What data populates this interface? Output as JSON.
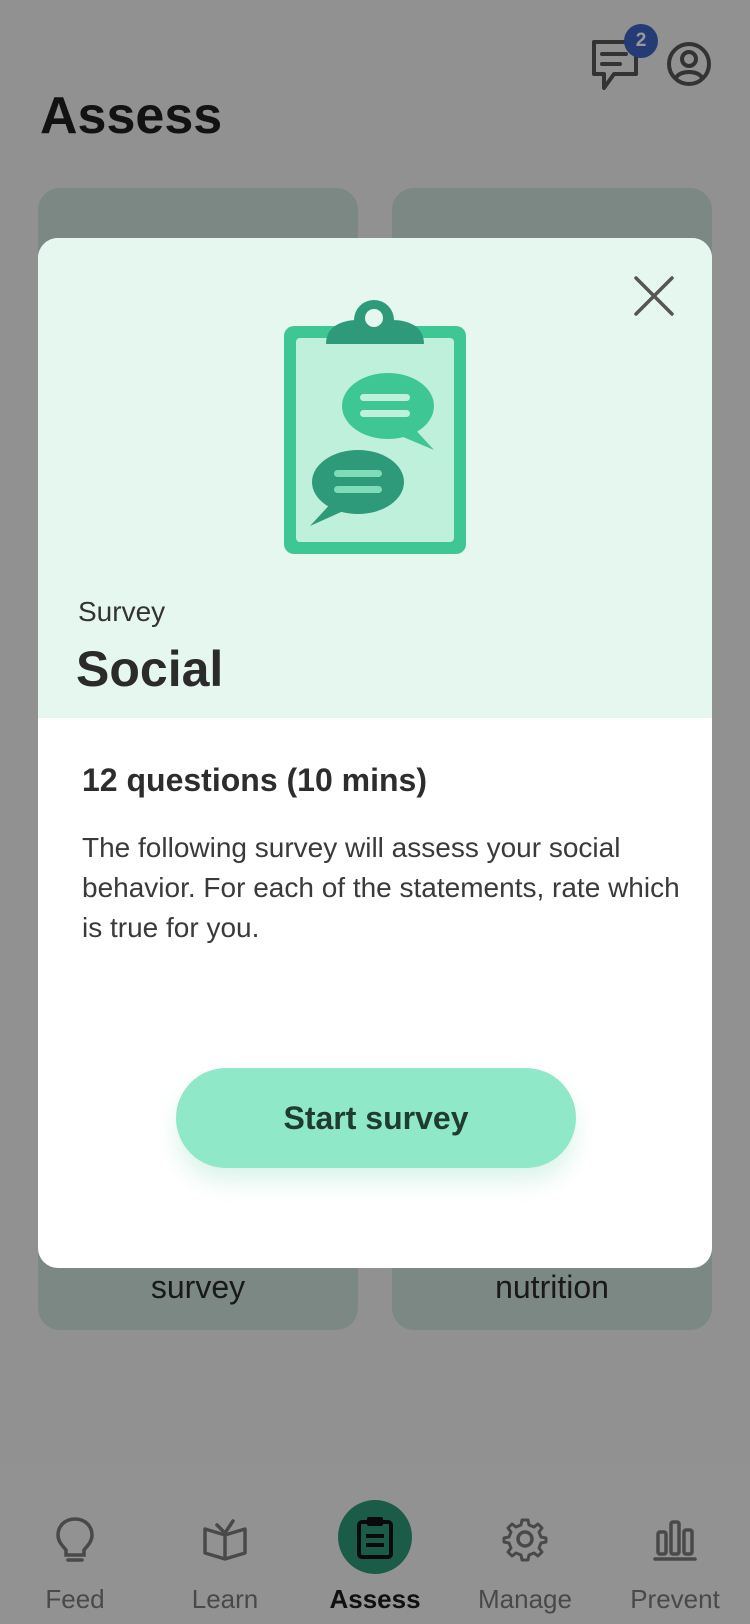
{
  "header": {
    "title": "Assess",
    "messages_badge": "2"
  },
  "background_cards": {
    "left_label": "survey",
    "right_label": "nutrition"
  },
  "modal": {
    "kicker": "Survey",
    "title": "Social",
    "meta": "12 questions (10 mins)",
    "description": "The following survey will assess your social behavior. For each of the statements, rate which is true for you.",
    "start_button": "Start survey",
    "colors": {
      "header_bg": "#e6f7f0",
      "button_bg": "#8fe8c8",
      "accent": "#2e9a7a"
    }
  },
  "tabbar": {
    "items": [
      {
        "label": "Feed",
        "icon": "lightbulb-icon"
      },
      {
        "label": "Learn",
        "icon": "open-book-icon"
      },
      {
        "label": "Assess",
        "icon": "clipboard-icon"
      },
      {
        "label": "Manage",
        "icon": "gear-icon"
      },
      {
        "label": "Prevent",
        "icon": "bar-chart-icon"
      }
    ],
    "active_index": 2
  }
}
